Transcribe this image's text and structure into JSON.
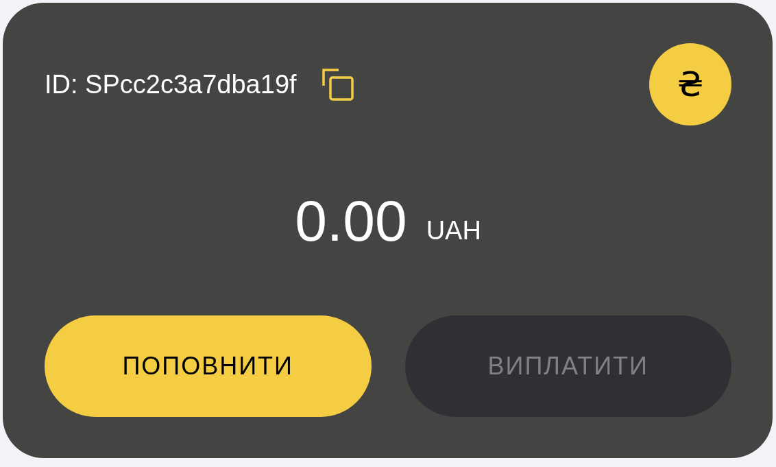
{
  "wallet": {
    "id_label": "ID: SPcc2c3a7dba19f",
    "currency_symbol": "₴",
    "amount": "0.00",
    "currency": "UAH"
  },
  "buttons": [
    {
      "label": "ПОПОВНИТИ",
      "disabled": false
    },
    {
      "label": "ВИПЛАТИТИ",
      "disabled": true
    }
  ]
}
